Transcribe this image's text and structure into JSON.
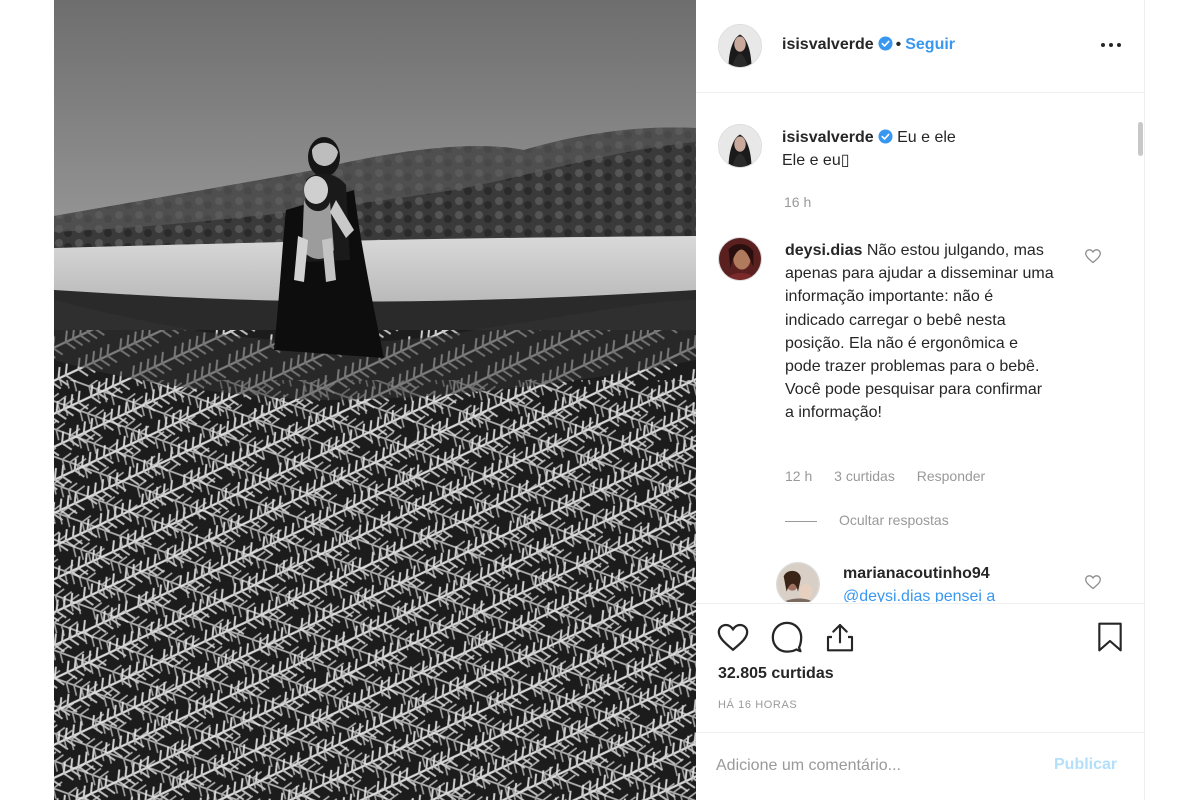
{
  "post": {
    "username": "isisvalverde",
    "dot": "•",
    "follow_label": "Seguir"
  },
  "caption": {
    "username": "isisvalverde",
    "line1": "Eu e ele",
    "line2": "Ele e eu▯",
    "time": "16 h"
  },
  "comments": [
    {
      "username": "deysi.dias",
      "text": "Não estou julgando, mas apenas para ajudar a disseminar uma informação importante: não é indicado carregar o bebê nesta posição. Ela não é ergonômica e pode trazer problemas para o bebê. Você pode pesquisar para confirmar a informação!",
      "time": "12 h",
      "likes": "3 curtidas",
      "reply_label": "Responder"
    }
  ],
  "hide_replies_label": "Ocultar respostas",
  "reply": {
    "username": "marianacoutinho94",
    "text": "@deysi.dias pensei a"
  },
  "actions": {
    "icons": [
      "heart-icon",
      "comment-icon",
      "share-icon",
      "bookmark-icon"
    ],
    "likes_count": "32.805 curtidas",
    "timestamp": "HÁ 16 HORAS"
  },
  "comment_box": {
    "placeholder": "Adicione um comentário...",
    "publish_label": "Publicar"
  },
  "colors": {
    "accent": "#3897f0",
    "publish_disabled": "#b2dffc",
    "muted": "#999999",
    "text": "#262626"
  }
}
